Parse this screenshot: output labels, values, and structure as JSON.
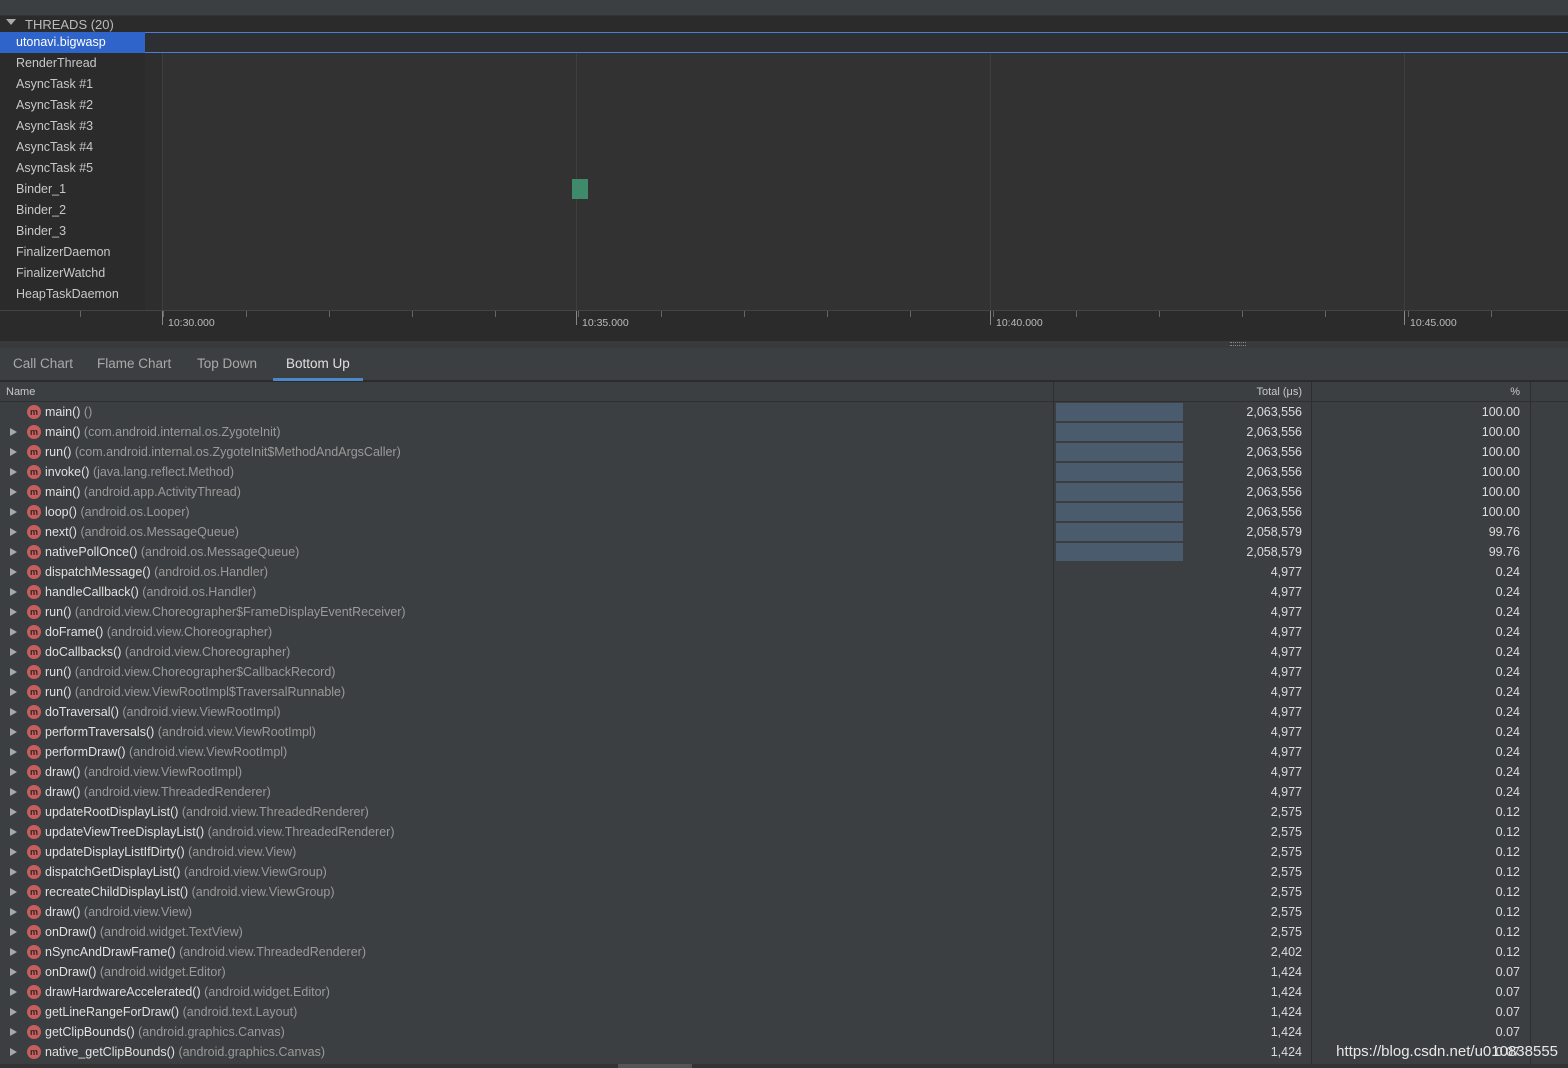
{
  "threads": {
    "header": "THREADS (20)",
    "items": [
      {
        "name": "utonavi.bigwasp",
        "selected": true
      },
      {
        "name": "RenderThread"
      },
      {
        "name": "AsyncTask #1"
      },
      {
        "name": "AsyncTask #2"
      },
      {
        "name": "AsyncTask #3"
      },
      {
        "name": "AsyncTask #4"
      },
      {
        "name": "AsyncTask #5"
      },
      {
        "name": "Binder_1"
      },
      {
        "name": "Binder_2"
      },
      {
        "name": "Binder_3"
      },
      {
        "name": "FinalizerDaemon"
      },
      {
        "name": "FinalizerWatchd"
      },
      {
        "name": "HeapTaskDaemon"
      }
    ]
  },
  "timeline": {
    "axis_labels": [
      "10:30.000",
      "10:35.000",
      "10:40.000",
      "10:45.000"
    ],
    "selection_color": "#2f65ca",
    "activity_color": "#3f8a6b"
  },
  "tabs": [
    {
      "label": "Call Chart"
    },
    {
      "label": "Flame Chart"
    },
    {
      "label": "Top Down"
    },
    {
      "label": "Bottom Up",
      "active": true
    }
  ],
  "table": {
    "columns": {
      "name": "Name",
      "total": "Total (μs)",
      "percent": "%"
    },
    "method_icon_letter": "m",
    "rows": [
      {
        "method": "main()",
        "cls": "()",
        "total": "2,063,556",
        "pct": "100.00",
        "ratio": 1.0,
        "expandable": false
      },
      {
        "method": "main()",
        "cls": "(com.android.internal.os.ZygoteInit)",
        "total": "2,063,556",
        "pct": "100.00",
        "ratio": 1.0
      },
      {
        "method": "run()",
        "cls": "(com.android.internal.os.ZygoteInit$MethodAndArgsCaller)",
        "total": "2,063,556",
        "pct": "100.00",
        "ratio": 1.0
      },
      {
        "method": "invoke()",
        "cls": "(java.lang.reflect.Method)",
        "total": "2,063,556",
        "pct": "100.00",
        "ratio": 1.0
      },
      {
        "method": "main()",
        "cls": "(android.app.ActivityThread)",
        "total": "2,063,556",
        "pct": "100.00",
        "ratio": 1.0
      },
      {
        "method": "loop()",
        "cls": "(android.os.Looper)",
        "total": "2,063,556",
        "pct": "100.00",
        "ratio": 1.0
      },
      {
        "method": "next()",
        "cls": "(android.os.MessageQueue)",
        "total": "2,058,579",
        "pct": "99.76",
        "ratio": 0.9976
      },
      {
        "method": "nativePollOnce()",
        "cls": "(android.os.MessageQueue)",
        "total": "2,058,579",
        "pct": "99.76",
        "ratio": 0.9976
      },
      {
        "method": "dispatchMessage()",
        "cls": "(android.os.Handler)",
        "total": "4,977",
        "pct": "0.24",
        "ratio": 0.0024
      },
      {
        "method": "handleCallback()",
        "cls": "(android.os.Handler)",
        "total": "4,977",
        "pct": "0.24",
        "ratio": 0.0024
      },
      {
        "method": "run()",
        "cls": "(android.view.Choreographer$FrameDisplayEventReceiver)",
        "total": "4,977",
        "pct": "0.24",
        "ratio": 0.0024
      },
      {
        "method": "doFrame()",
        "cls": "(android.view.Choreographer)",
        "total": "4,977",
        "pct": "0.24",
        "ratio": 0.0024
      },
      {
        "method": "doCallbacks()",
        "cls": "(android.view.Choreographer)",
        "total": "4,977",
        "pct": "0.24",
        "ratio": 0.0024
      },
      {
        "method": "run()",
        "cls": "(android.view.Choreographer$CallbackRecord)",
        "total": "4,977",
        "pct": "0.24",
        "ratio": 0.0024
      },
      {
        "method": "run()",
        "cls": "(android.view.ViewRootImpl$TraversalRunnable)",
        "total": "4,977",
        "pct": "0.24",
        "ratio": 0.0024
      },
      {
        "method": "doTraversal()",
        "cls": "(android.view.ViewRootImpl)",
        "total": "4,977",
        "pct": "0.24",
        "ratio": 0.0024
      },
      {
        "method": "performTraversals()",
        "cls": "(android.view.ViewRootImpl)",
        "total": "4,977",
        "pct": "0.24",
        "ratio": 0.0024
      },
      {
        "method": "performDraw()",
        "cls": "(android.view.ViewRootImpl)",
        "total": "4,977",
        "pct": "0.24",
        "ratio": 0.0024
      },
      {
        "method": "draw()",
        "cls": "(android.view.ViewRootImpl)",
        "total": "4,977",
        "pct": "0.24",
        "ratio": 0.0024
      },
      {
        "method": "draw()",
        "cls": "(android.view.ThreadedRenderer)",
        "total": "4,977",
        "pct": "0.24",
        "ratio": 0.0024
      },
      {
        "method": "updateRootDisplayList()",
        "cls": "(android.view.ThreadedRenderer)",
        "total": "2,575",
        "pct": "0.12",
        "ratio": 0.0012
      },
      {
        "method": "updateViewTreeDisplayList()",
        "cls": "(android.view.ThreadedRenderer)",
        "total": "2,575",
        "pct": "0.12",
        "ratio": 0.0012
      },
      {
        "method": "updateDisplayListIfDirty()",
        "cls": "(android.view.View)",
        "total": "2,575",
        "pct": "0.12",
        "ratio": 0.0012
      },
      {
        "method": "dispatchGetDisplayList()",
        "cls": "(android.view.ViewGroup)",
        "total": "2,575",
        "pct": "0.12",
        "ratio": 0.0012
      },
      {
        "method": "recreateChildDisplayList()",
        "cls": "(android.view.ViewGroup)",
        "total": "2,575",
        "pct": "0.12",
        "ratio": 0.0012
      },
      {
        "method": "draw()",
        "cls": "(android.view.View)",
        "total": "2,575",
        "pct": "0.12",
        "ratio": 0.0012
      },
      {
        "method": "onDraw()",
        "cls": "(android.widget.TextView)",
        "total": "2,575",
        "pct": "0.12",
        "ratio": 0.0012
      },
      {
        "method": "nSyncAndDrawFrame()",
        "cls": "(android.view.ThreadedRenderer)",
        "total": "2,402",
        "pct": "0.12",
        "ratio": 0.0012
      },
      {
        "method": "onDraw()",
        "cls": "(android.widget.Editor)",
        "total": "1,424",
        "pct": "0.07",
        "ratio": 0.0007
      },
      {
        "method": "drawHardwareAccelerated()",
        "cls": "(android.widget.Editor)",
        "total": "1,424",
        "pct": "0.07",
        "ratio": 0.0007
      },
      {
        "method": "getLineRangeForDraw()",
        "cls": "(android.text.Layout)",
        "total": "1,424",
        "pct": "0.07",
        "ratio": 0.0007
      },
      {
        "method": "getClipBounds()",
        "cls": "(android.graphics.Canvas)",
        "total": "1,424",
        "pct": "0.07",
        "ratio": 0.0007
      },
      {
        "method": "native_getClipBounds()",
        "cls": "(android.graphics.Canvas)",
        "total": "1,424",
        "pct": "0.07",
        "ratio": 0.0007
      }
    ]
  },
  "watermark": "https://blog.csdn.net/u010838555",
  "colors": {
    "bar": "#4a5b6d",
    "method_icon": "#c75d5d",
    "tab_underline": "#4a88c7"
  }
}
